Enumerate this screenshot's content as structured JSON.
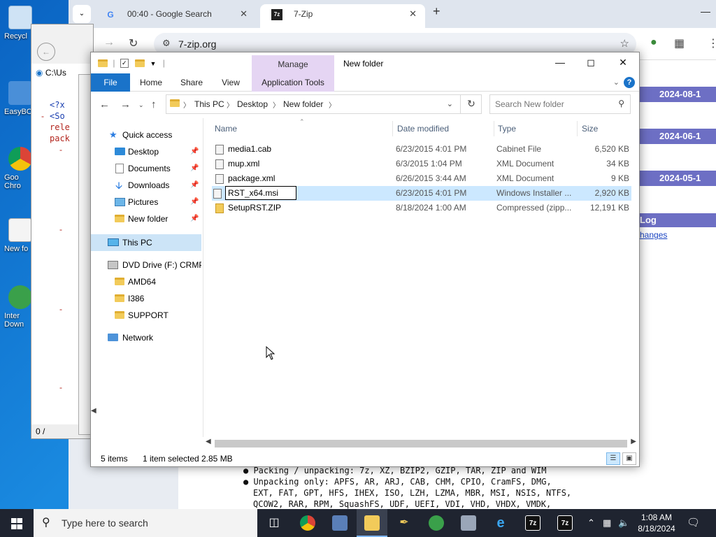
{
  "desktop": {
    "icons": [
      {
        "label": "Recycl",
        "color": "#9fc5e8"
      },
      {
        "label": "EasyBC",
        "color": "#4a8fd8"
      },
      {
        "label": "Goo Chro",
        "color": "#e04a3a"
      },
      {
        "label": "New fo",
        "color": "#f2f2f2"
      },
      {
        "label": "Inter Down",
        "color": "#3aa04a"
      }
    ]
  },
  "chrome": {
    "tabs": [
      {
        "title": "00:40 - Google Search",
        "favicon": "G"
      },
      {
        "title": "7-Zip",
        "favicon": "7z"
      }
    ],
    "url": "7-zip.org"
  },
  "zip_page": {
    "dates": [
      "2024-08-1",
      "2024-06-1",
      "2024-05-1"
    ],
    "log_label": "Log",
    "changes_link": "hanges",
    "features": [
      "Packing / unpacking: 7z, XZ, BZIP2, GZIP, TAR, ZIP and WIM",
      "Unpacking only: APFS, AR, ARJ, CAB, CHM, CPIO, CramFS, DMG,",
      "EXT, FAT, GPT, HFS, IHEX, ISO, LZH, LZMA, MBR, MSI, NSIS, NTFS,",
      "QCOW2, RAR, RPM, SquashFS, UDF, UEFI, VDI, VHD, VHDX, VMDK,"
    ]
  },
  "xml_window": {
    "address": "C:\\Us",
    "lines": [
      "<?x",
      "<So",
      "rele",
      "pack"
    ],
    "status": "0 /"
  },
  "explorer": {
    "title": "New folder",
    "manage_label": "Manage",
    "ribbon": {
      "file": "File",
      "home": "Home",
      "share": "Share",
      "view": "View",
      "app_tools": "Application Tools"
    },
    "breadcrumb": [
      "This PC",
      "Desktop",
      "New folder"
    ],
    "search_placeholder": "Search New folder",
    "nav": {
      "quick_access": "Quick access",
      "desktop": "Desktop",
      "documents": "Documents",
      "downloads": "Downloads",
      "pictures": "Pictures",
      "new_folder": "New folder",
      "this_pc": "This PC",
      "dvd": "DVD Drive (F:) CRMP",
      "amd64": "AMD64",
      "i386": "I386",
      "support": "SUPPORT",
      "network": "Network"
    },
    "columns": {
      "name": "Name",
      "date": "Date modified",
      "type": "Type",
      "size": "Size"
    },
    "files": [
      {
        "name": "media1.cab",
        "date": "6/23/2015 4:01 PM",
        "type": "Cabinet File",
        "size": "6,520 KB"
      },
      {
        "name": "mup.xml",
        "date": "6/3/2015 1:04 PM",
        "type": "XML Document",
        "size": "34 KB"
      },
      {
        "name": "package.xml",
        "date": "6/26/2015 3:44 AM",
        "type": "XML Document",
        "size": "9 KB"
      },
      {
        "name": "RST_x64.msi",
        "date": "6/23/2015 4:01 PM",
        "type": "Windows Installer ...",
        "size": "2,920 KB"
      },
      {
        "name": "SetupRST.ZIP",
        "date": "8/18/2024 1:00 AM",
        "type": "Compressed (zipp...",
        "size": "12,191 KB"
      }
    ],
    "status": {
      "items": "5 items",
      "selected": "1 item selected",
      "size": "2.85 MB"
    }
  },
  "taskbar": {
    "search_placeholder": "Type here to search",
    "time": "1:08 AM",
    "date": "8/18/2024",
    "apps": [
      "task-view-icon",
      "chrome-icon",
      "server-manager-icon",
      "file-explorer-icon",
      "pen-icon",
      "ie-download-icon",
      "hdd-icon",
      "ie-icon",
      "7zip-icon",
      "7zip-icon"
    ]
  }
}
